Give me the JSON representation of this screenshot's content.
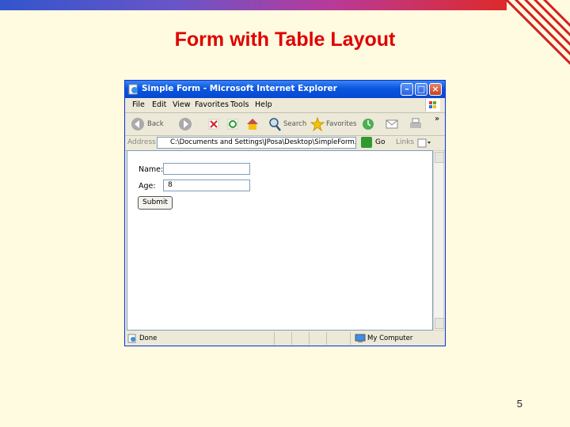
{
  "slide": {
    "title": "Form with Table Layout",
    "page_number": "5"
  },
  "browser": {
    "window_title": "Simple Form - Microsoft Internet Explorer",
    "menu": [
      "File",
      "Edit",
      "View",
      "Favorites",
      "Tools",
      "Help"
    ],
    "toolbar": {
      "back_label": "Back",
      "search_label": "Search",
      "favorites_label": "Favorites"
    },
    "address": {
      "label": "Address",
      "value": "C:\\Documents and Settings\\JPosa\\Desktop\\SimpleForm.html",
      "go_label": "Go",
      "links_label": "Links"
    },
    "status": {
      "left": "Done",
      "zone": "My Computer"
    }
  },
  "form": {
    "name_label": "Name:",
    "name_value": "",
    "age_label": "Age:",
    "age_value": "8",
    "submit_label": "Submit"
  },
  "colors": {
    "slide_background": "#fffbe0",
    "title": "#e00000",
    "xp_titlebar": "#0a56e0"
  }
}
